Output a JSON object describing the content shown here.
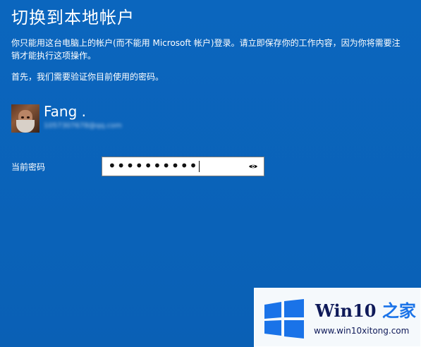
{
  "page": {
    "title": "切换到本地帐户",
    "description": "你只能用这台电脑上的帐户(而不能用 Microsoft 帐户)登录。请立即保存你的工作内容，因为你将需要注销才能执行这项操作。",
    "hint": "首先，我们需要验证你目前使用的密码。"
  },
  "account": {
    "name": "Fang .",
    "email_masked": "1057307678@qq.com",
    "avatar_icon": "user-avatar-icon"
  },
  "password": {
    "label": "当前密码",
    "value": "••••••••••",
    "reveal_icon": "eye-icon"
  },
  "watermark": {
    "brand_main": "Win10",
    "brand_suffix": "之家",
    "url": "www.win10xitong.com",
    "logo_icon": "windows-logo-icon"
  },
  "colors": {
    "background": "#0b66be",
    "text": "#ffffff",
    "input_bg": "#ffffff",
    "watermark_blue": "#1a73e8"
  }
}
